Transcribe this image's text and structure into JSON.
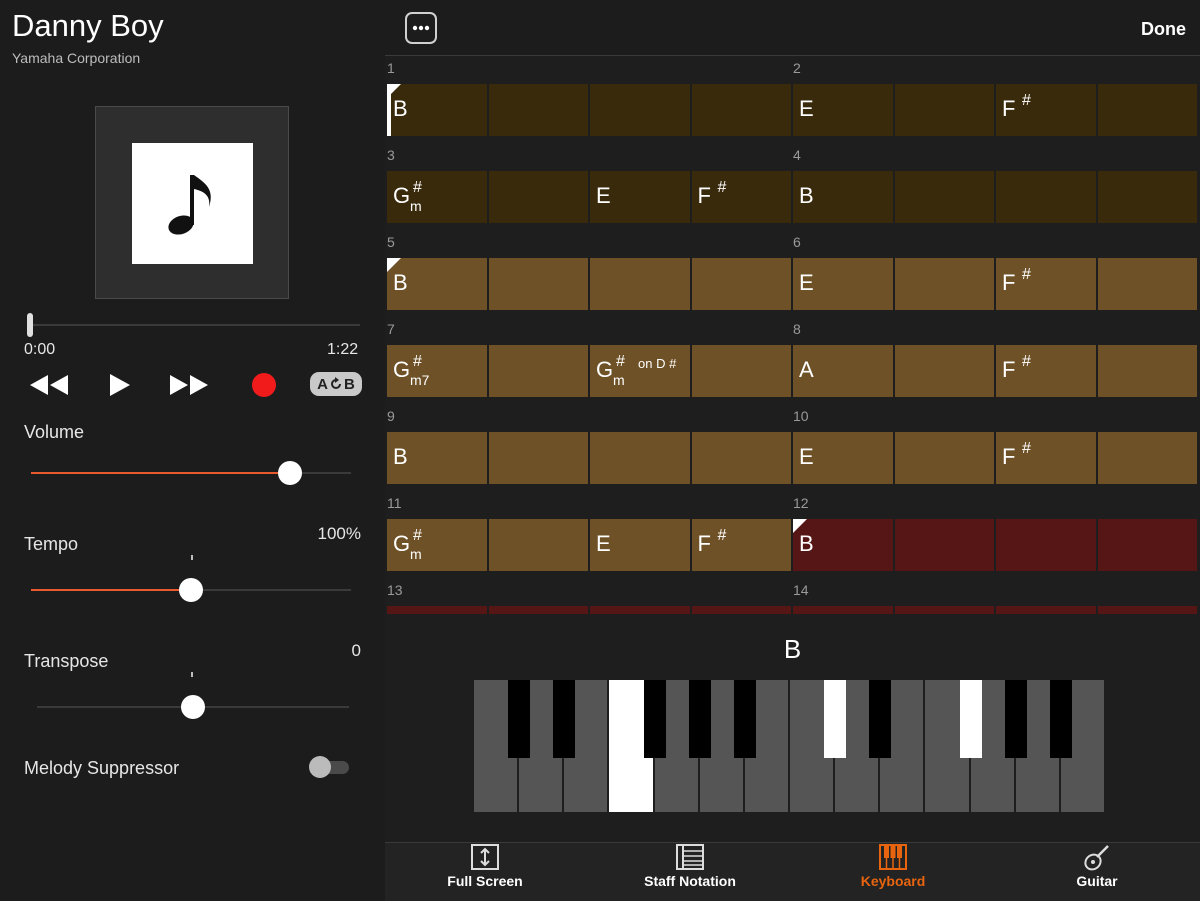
{
  "song": {
    "title": "Danny Boy",
    "artist": "Yamaha Corporation"
  },
  "player": {
    "time_current": "0:00",
    "time_total": "1:22",
    "progress": 0.0,
    "ab_label_a": "A",
    "ab_label_b": "B"
  },
  "settings": {
    "volume_label": "Volume",
    "volume_level": 0.81,
    "tempo_label": "Tempo",
    "tempo_value": "100%",
    "tempo_level": 0.5,
    "transpose_label": "Transpose",
    "transpose_value": "0",
    "transpose_level": 0.5,
    "melody_suppressor_label": "Melody Suppressor",
    "melody_suppressor_on": false
  },
  "header": {
    "done_label": "Done"
  },
  "colors": {
    "accent": "#e8592d",
    "active_tab": "#e8640f",
    "record": "#f21b1b",
    "bar_dark": "#3a2a0c",
    "bar_light": "#6e5127",
    "bar_current": "#561616"
  },
  "chord_grid": {
    "bars": [
      {
        "num": "1",
        "cells": [
          {
            "root": "B",
            "corner": true,
            "playhead": true
          },
          {},
          {},
          {}
        ]
      },
      {
        "num": "2",
        "cells": [
          {
            "root": "E"
          },
          {},
          {
            "root": "F",
            "acc": "#"
          },
          {}
        ]
      },
      {
        "num": "3",
        "cells": [
          {
            "root": "G",
            "acc": "#",
            "q": "m"
          },
          {},
          {
            "root": "E"
          },
          {
            "root": "F",
            "acc": "#"
          }
        ]
      },
      {
        "num": "4",
        "cells": [
          {
            "root": "B"
          },
          {},
          {},
          {}
        ]
      },
      {
        "num": "5",
        "cells": [
          {
            "root": "B",
            "corner": true
          },
          {},
          {},
          {}
        ]
      },
      {
        "num": "6",
        "cells": [
          {
            "root": "E"
          },
          {},
          {
            "root": "F",
            "acc": "#"
          },
          {}
        ]
      },
      {
        "num": "7",
        "cells": [
          {
            "root": "G",
            "acc": "#",
            "q": "m7"
          },
          {},
          {
            "root": "G",
            "acc": "#",
            "q": "m",
            "on": "on D #"
          },
          {}
        ]
      },
      {
        "num": "8",
        "cells": [
          {
            "root": "A"
          },
          {},
          {
            "root": "F",
            "acc": "#"
          },
          {}
        ]
      },
      {
        "num": "9",
        "cells": [
          {
            "root": "B"
          },
          {},
          {},
          {}
        ]
      },
      {
        "num": "10",
        "cells": [
          {
            "root": "E"
          },
          {},
          {
            "root": "F",
            "acc": "#"
          },
          {}
        ]
      },
      {
        "num": "11",
        "cells": [
          {
            "root": "G",
            "acc": "#",
            "q": "m"
          },
          {},
          {
            "root": "E"
          },
          {
            "root": "F",
            "acc": "#"
          }
        ]
      },
      {
        "num": "12",
        "cells": [
          {
            "root": "B",
            "corner": true
          },
          {},
          {},
          {}
        ]
      },
      {
        "num": "13",
        "cells": [
          {},
          {},
          {},
          {}
        ]
      },
      {
        "num": "14",
        "cells": [
          {},
          {},
          {},
          {}
        ]
      }
    ]
  },
  "keyboard": {
    "current_chord": "B",
    "pressed_white": [
      3
    ],
    "pressed_black": [
      5,
      7
    ]
  },
  "tabs": [
    {
      "label": "Full Screen",
      "icon": "full-screen-icon",
      "active": false
    },
    {
      "label": "Staff Notation",
      "icon": "staff-notation-icon",
      "active": false
    },
    {
      "label": "Keyboard",
      "icon": "keyboard-icon",
      "active": true
    },
    {
      "label": "Guitar",
      "icon": "guitar-icon",
      "active": false
    }
  ]
}
